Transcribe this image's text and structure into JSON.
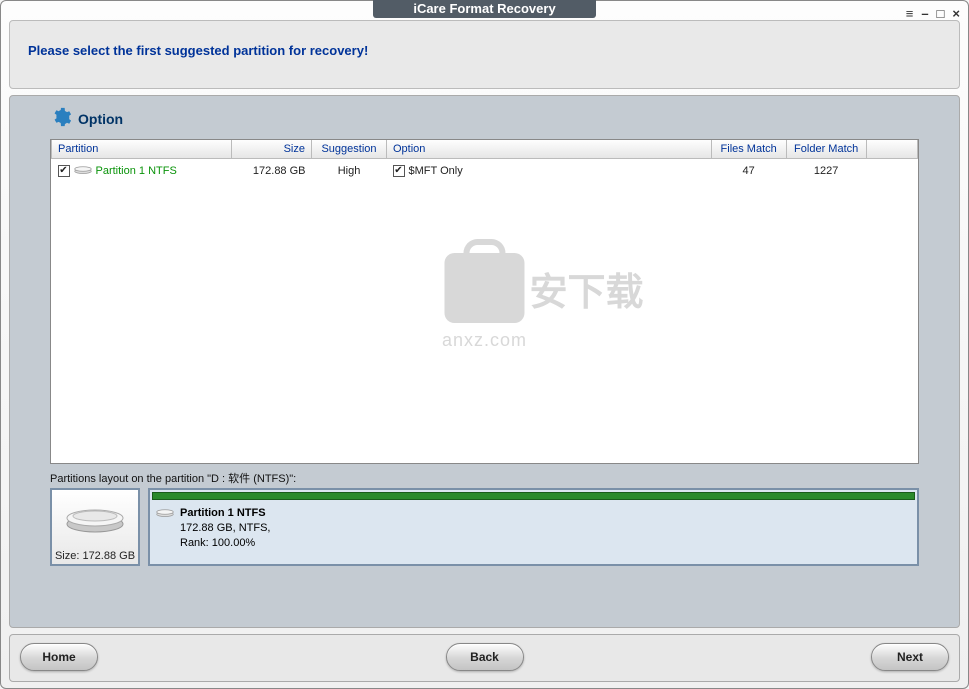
{
  "window": {
    "title": "iCare Format Recovery"
  },
  "instruction": "Please select the first suggested partition for recovery!",
  "optionHeader": "Option",
  "table": {
    "headers": {
      "partition": "Partition",
      "size": "Size",
      "suggestion": "Suggestion",
      "option": "Option",
      "filesMatch": "Files Match",
      "folderMatch": "Folder Match"
    },
    "rows": [
      {
        "checked": true,
        "name": "Partition 1 NTFS",
        "size": "172.88 GB",
        "suggestion": "High",
        "optChecked": true,
        "option": "$MFT Only",
        "files": "47",
        "folders": "1227"
      }
    ]
  },
  "watermark": {
    "cn": "安下载",
    "url": "anxz.com"
  },
  "layoutLabel": "Partitions layout on the partition \"D : 软件  (NTFS)\":",
  "driveBox": {
    "size": "Size: 172.88 GB"
  },
  "partitionBlock": {
    "title": "Partition 1 NTFS",
    "line2": "172.88 GB, NTFS,",
    "line3": "Rank: 100.00%"
  },
  "buttons": {
    "home": "Home",
    "back": "Back",
    "next": "Next"
  }
}
